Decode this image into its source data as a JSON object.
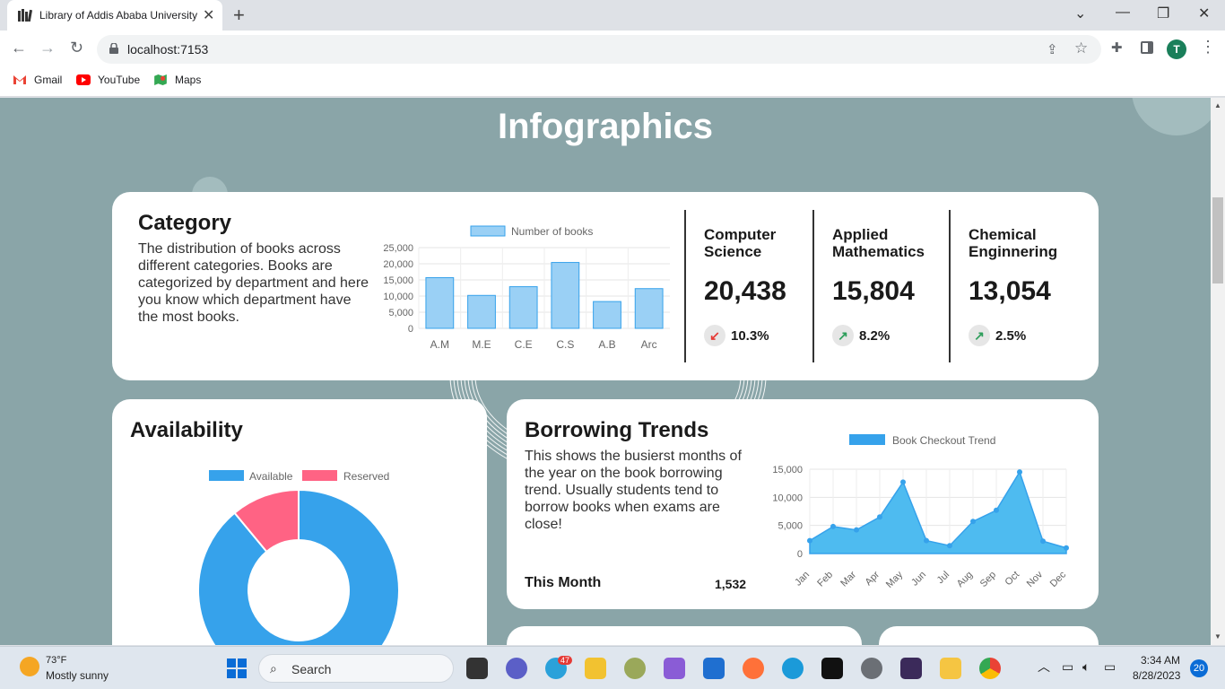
{
  "browser": {
    "tab_title": "Library of Addis Ababa University",
    "url": "localhost:7153",
    "avatar_letter": "T",
    "bookmarks": [
      {
        "label": "Gmail",
        "icon": "gmail-icon"
      },
      {
        "label": "YouTube",
        "icon": "youtube-icon"
      },
      {
        "label": "Maps",
        "icon": "maps-icon"
      }
    ]
  },
  "page": {
    "title": "Infographics",
    "category": {
      "heading": "Category",
      "description": "The distribution of books across different categories. Books are categorized by department and here you know which department have the most books.",
      "stats": [
        {
          "label": "Computer Science",
          "value": "20,438",
          "change": "10.3%",
          "trend": "down"
        },
        {
          "label": "Applied Mathematics",
          "value": "15,804",
          "change": "8.2%",
          "trend": "up"
        },
        {
          "label": "Chemical Enginnering",
          "value": "13,054",
          "change": "2.5%",
          "trend": "up"
        }
      ]
    },
    "availability": {
      "heading": "Availability"
    },
    "borrowing": {
      "heading": "Borrowing Trends",
      "description": "This shows the busierst months of the year on the book borrowing trend. Usually students tend to borrow books when exams are close!",
      "this_month_label": "This Month",
      "this_month_value": "1,532"
    }
  },
  "chart_data": [
    {
      "type": "bar",
      "legend": [
        "Number of books"
      ],
      "categories": [
        "A.M",
        "M.E",
        "C.E",
        "C.S",
        "A.B",
        "Arc"
      ],
      "series": [
        {
          "name": "Number of books",
          "values": [
            15700,
            10200,
            12900,
            20400,
            8300,
            12300
          ]
        }
      ],
      "ylim": [
        0,
        25000
      ],
      "yticks": [
        "0",
        "5,000",
        "10,000",
        "15,000",
        "20,000",
        "25,000"
      ],
      "color": "#9ad0f5",
      "grid": true,
      "legend_position": "top"
    },
    {
      "type": "pie",
      "legend": [
        "Available",
        "Reserved"
      ],
      "values": [
        89,
        11
      ],
      "colors": [
        "#36a2eb",
        "#ff6384"
      ],
      "donut": true,
      "legend_position": "top"
    },
    {
      "type": "area",
      "legend": [
        "Book Checkout Trend"
      ],
      "categories": [
        "Jan",
        "Feb",
        "Mar",
        "Apr",
        "May",
        "Jun",
        "Jul",
        "Aug",
        "Sep",
        "Oct",
        "Nov",
        "Dec"
      ],
      "series": [
        {
          "name": "Book Checkout Trend",
          "values": [
            2300,
            4800,
            4200,
            6500,
            12700,
            2300,
            1400,
            5700,
            7700,
            14500,
            2200,
            1000
          ]
        }
      ],
      "ylim": [
        0,
        15000
      ],
      "yticks": [
        "0",
        "5,000",
        "10,000",
        "15,000"
      ],
      "color": "#36a2eb",
      "grid": true,
      "legend_position": "top"
    }
  ],
  "taskbar": {
    "weather_temp": "73°F",
    "weather_desc": "Mostly sunny",
    "search_label": "Search",
    "telegram_badge": "47",
    "time": "3:34 AM",
    "date": "8/28/2023",
    "notifications": "20"
  }
}
